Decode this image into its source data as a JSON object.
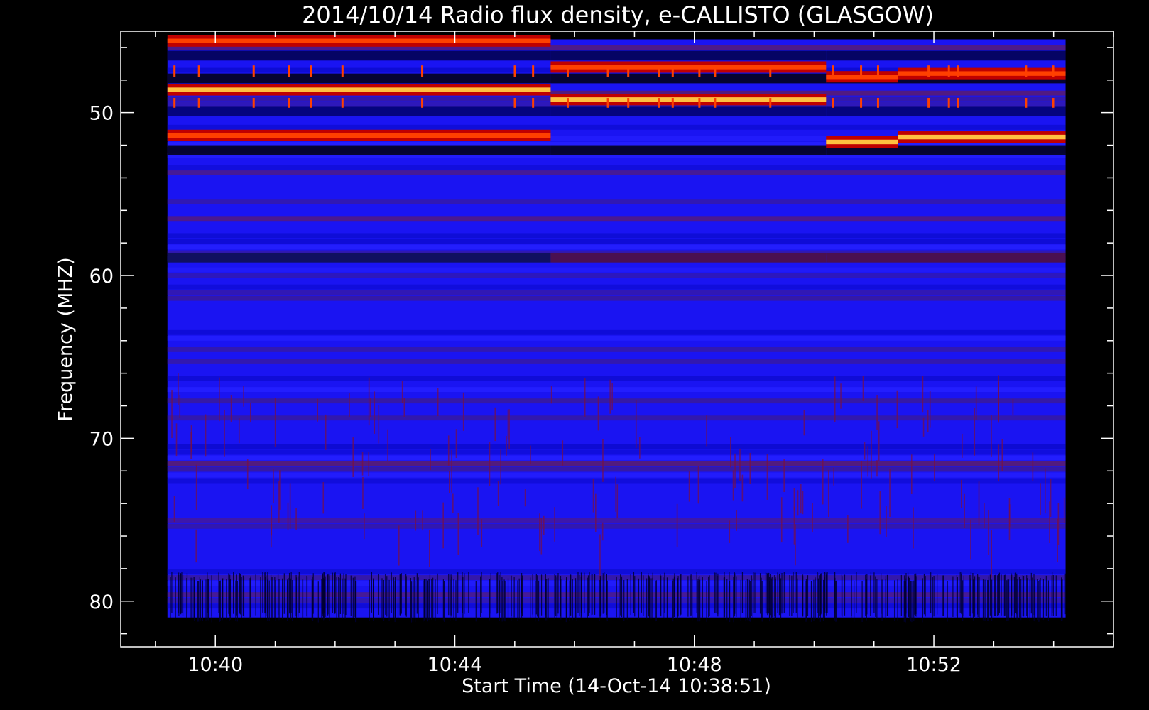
{
  "chart_data": {
    "type": "heatmap",
    "title": "2014/10/14  Radio flux density, e-CALLISTO (GLASGOW)",
    "xlabel": "Start Time (14-Oct-14 10:38:51)",
    "ylabel": "Frequency (MHZ)",
    "x_ticks": [
      "10:40",
      "10:44",
      "10:48",
      "10:52"
    ],
    "y_ticks": [
      "50",
      "60",
      "70",
      "80"
    ],
    "y_tick_values": [
      50,
      60,
      70,
      80
    ],
    "x_tick_minutes": [
      40,
      44,
      48,
      52
    ],
    "xlim_minutes": [
      38.42,
      55.0
    ],
    "ylim_mhz": [
      45.0,
      82.8
    ],
    "data_xlim_minutes": [
      39.2,
      54.2
    ],
    "data_ylim_mhz": [
      45.5,
      81.0
    ],
    "grid": false,
    "legend": "none",
    "colormap": [
      "#000000",
      "#000080",
      "#1010ff",
      "#800040",
      "#c00000",
      "#ff4000",
      "#ffc040",
      "#ffffff"
    ],
    "segments": [
      {
        "start_min": 39.2,
        "end_min": 40.4,
        "bright_bands_mhz": [
          45.6,
          48.6,
          51.4
        ]
      },
      {
        "start_min": 40.4,
        "end_min": 45.6,
        "bright_bands_mhz": [
          45.6,
          48.6,
          51.4
        ]
      },
      {
        "start_min": 45.6,
        "end_min": 50.2,
        "bright_bands_mhz": [
          47.2,
          49.2
        ]
      },
      {
        "start_min": 50.2,
        "end_min": 51.4,
        "bright_bands_mhz": [
          47.8,
          51.8
        ]
      },
      {
        "start_min": 51.4,
        "end_min": 54.2,
        "bright_bands_mhz": [
          47.6,
          51.5
        ]
      }
    ]
  }
}
